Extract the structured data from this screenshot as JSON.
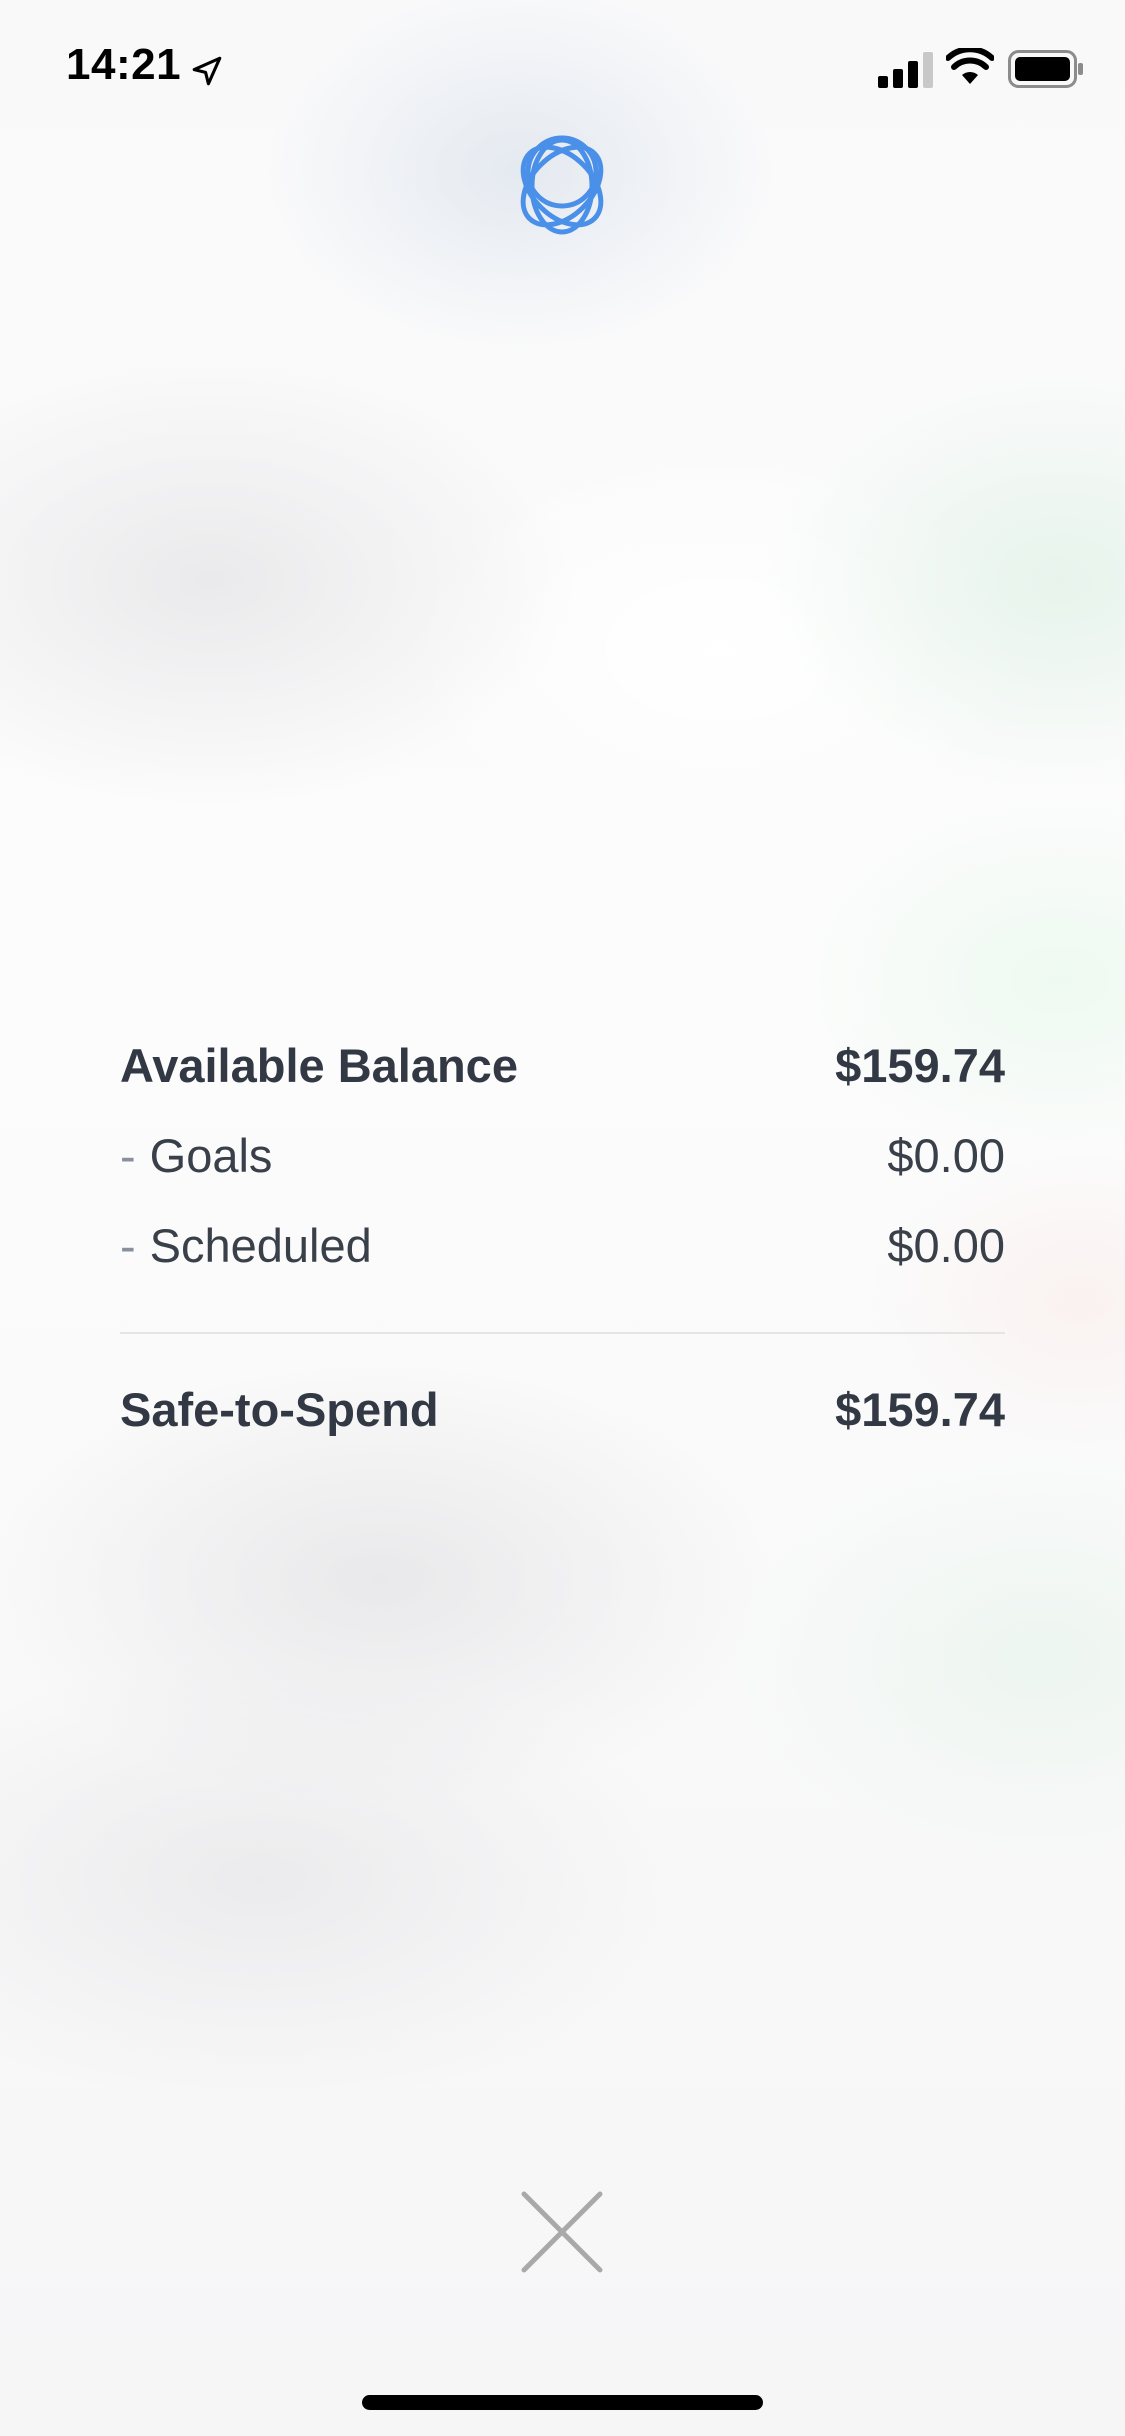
{
  "status_bar": {
    "time": "14:21",
    "icons": [
      "location-arrow-icon",
      "cellular-signal-icon",
      "wifi-icon",
      "battery-icon"
    ]
  },
  "header": {
    "logo_icon": "interlocking-rings-logo-icon",
    "logo_color": "#4a90e8"
  },
  "breakdown": {
    "rows": [
      {
        "label": "Available Balance",
        "value": "$159.74",
        "bold": true
      },
      {
        "label": "Goals",
        "prefix": "-",
        "value": "$0.00",
        "bold": false
      },
      {
        "label": "Scheduled",
        "prefix": "-",
        "value": "$0.00",
        "bold": false
      }
    ],
    "total": {
      "label": "Safe-to-Spend",
      "value": "$159.74"
    }
  },
  "close": {
    "icon": "close-x-icon",
    "color": "#a9a9aa"
  }
}
